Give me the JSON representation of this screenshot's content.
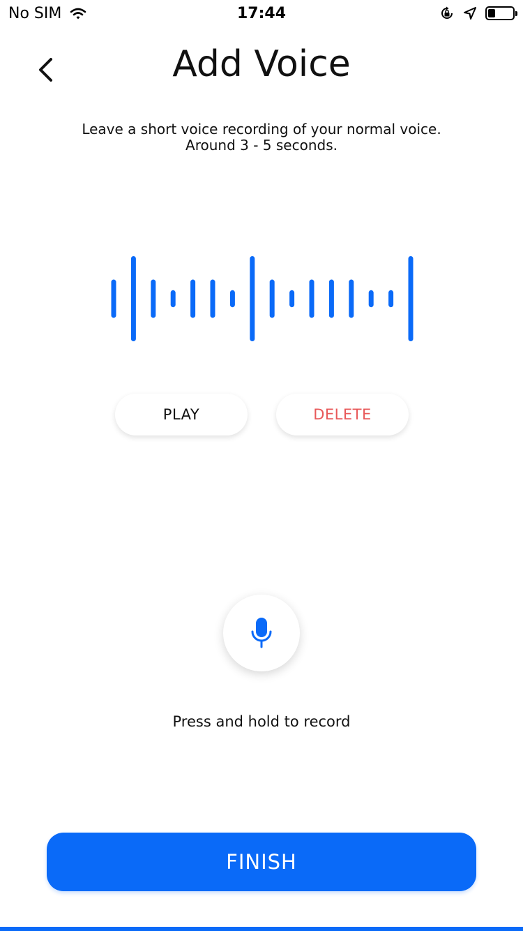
{
  "status_bar": {
    "carrier": "No SIM",
    "time": "17:44",
    "battery_level": 0.3
  },
  "header": {
    "title": "Add Voice",
    "back_icon": "chevron-left-icon"
  },
  "instructions": {
    "line1": "Leave a short voice recording of your normal voice.",
    "line2": "Around 3 - 5 seconds."
  },
  "waveform": {
    "color": "#0a6af8",
    "levels": [
      0.45,
      1.0,
      0.45,
      0.2,
      0.45,
      0.45,
      0.2,
      1.0,
      0.45,
      0.2,
      0.45,
      0.45,
      0.45,
      0.2,
      0.2,
      1.0
    ]
  },
  "actions": {
    "play_label": "PLAY",
    "delete_label": "DELETE"
  },
  "recorder": {
    "icon": "microphone-icon",
    "hint": "Press and hold to record"
  },
  "footer": {
    "finish_label": "FINISH"
  },
  "colors": {
    "accent": "#0a6af8",
    "danger": "#e8595a"
  }
}
